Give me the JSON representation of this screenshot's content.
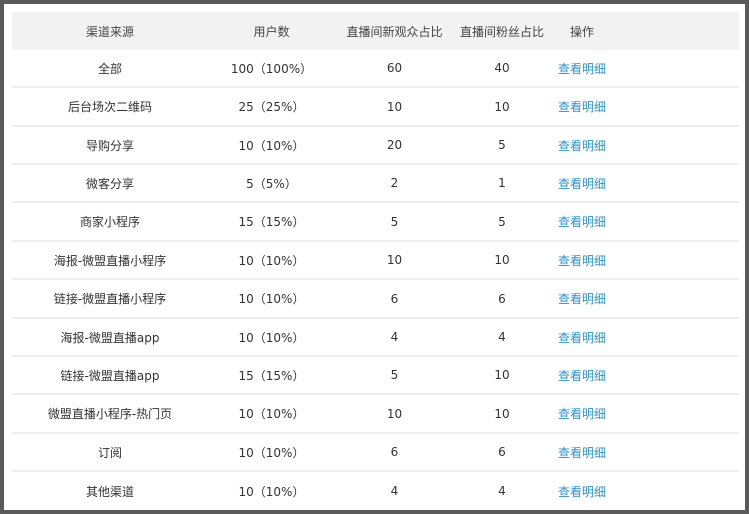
{
  "columns": [
    "渠道来源",
    "用户数",
    "直播间新观众占比",
    "直播间粉丝占比",
    "操作"
  ],
  "rows": [
    {
      "source": "全部",
      "users": "100（100%）",
      "new_viewer": "60",
      "fan": "40",
      "action": "查看明细"
    },
    {
      "source": "后台场次二维码",
      "users": "25（25%）",
      "new_viewer": "10",
      "fan": "10",
      "action": "查看明细"
    },
    {
      "source": "导购分享",
      "users": "10（10%）",
      "new_viewer": "20",
      "fan": "5",
      "action": "查看明细"
    },
    {
      "source": "微客分享",
      "users": "5（5%）",
      "new_viewer": "2",
      "fan": "1",
      "action": "查看明细"
    },
    {
      "source": "商家小程序",
      "users": "15（15%）",
      "new_viewer": "5",
      "fan": "5",
      "action": "查看明细"
    },
    {
      "source": "海报-微盟直播小程序",
      "users": "10（10%）",
      "new_viewer": "10",
      "fan": "10",
      "action": "查看明细"
    },
    {
      "source": "链接-微盟直播小程序",
      "users": "10（10%）",
      "new_viewer": "6",
      "fan": "6",
      "action": "查看明细"
    },
    {
      "source": "海报-微盟直播app",
      "users": "10（10%）",
      "new_viewer": "4",
      "fan": "4",
      "action": "查看明细"
    },
    {
      "source": "链接-微盟直播app",
      "users": "15（15%）",
      "new_viewer": "5",
      "fan": "10",
      "action": "查看明细"
    },
    {
      "source": "微盟直播小程序-热门页",
      "users": "10（10%）",
      "new_viewer": "10",
      "fan": "10",
      "action": "查看明细"
    },
    {
      "source": "订阅",
      "users": "10（10%）",
      "new_viewer": "6",
      "fan": "6",
      "action": "查看明细"
    },
    {
      "source": "其他渠道",
      "users": "10（10%）",
      "new_viewer": "4",
      "fan": "4",
      "action": "查看明细"
    }
  ]
}
